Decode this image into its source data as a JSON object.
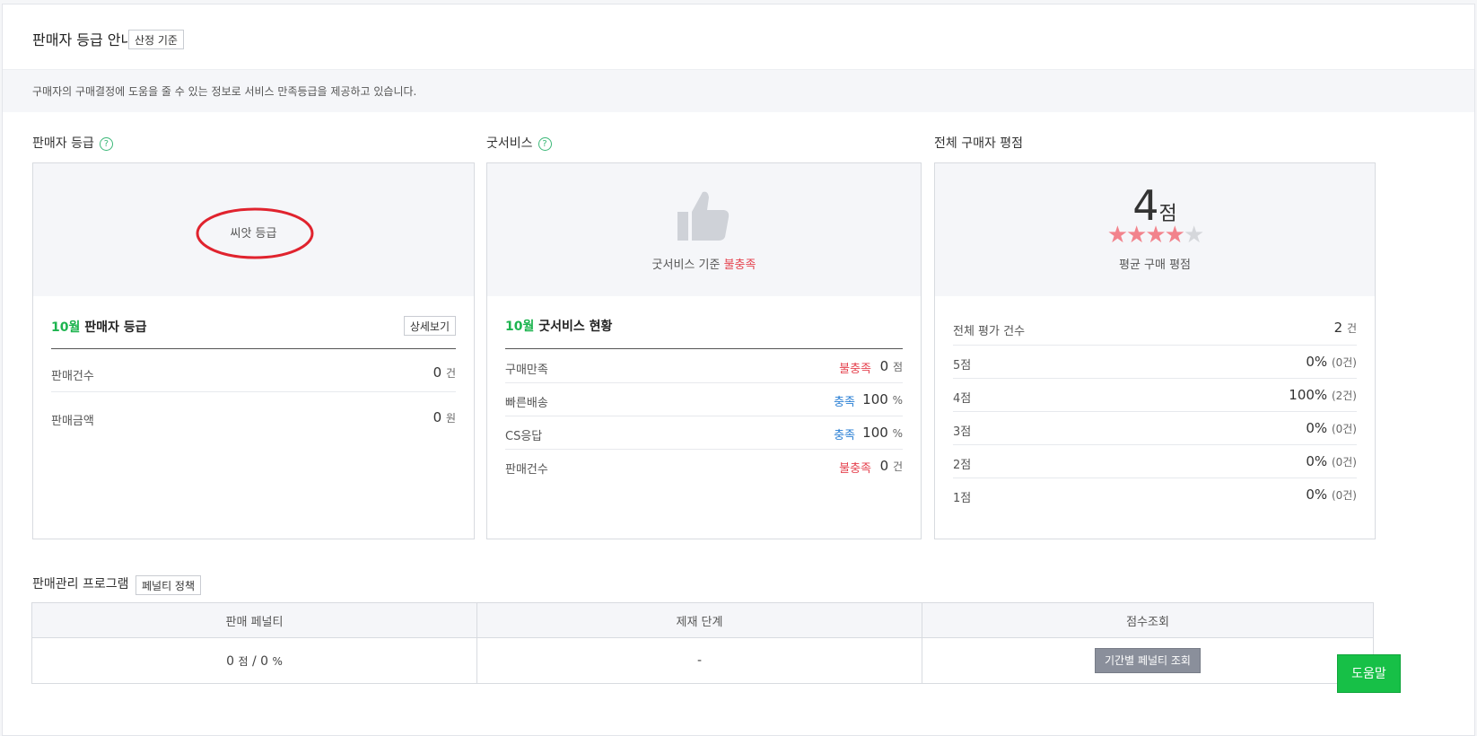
{
  "header": {
    "title": "판매자 등급 안내",
    "criteria_button": "산정 기준"
  },
  "info": {
    "text": "구매자의 구매결정에 도움을 줄 수 있는 정보로 서비스 만족등급을 제공하고 있습니다."
  },
  "grade": {
    "section_title": "판매자 등급",
    "help": "?",
    "grade_name": "씨앗 등급",
    "month": "10월",
    "subtitle": "판매자 등급",
    "detail_button": "상세보기",
    "rows": [
      {
        "label": "판매건수",
        "value": "0",
        "unit": "건"
      },
      {
        "label": "판매금액",
        "value": "0",
        "unit": "원"
      }
    ]
  },
  "good_service": {
    "section_title": "굿서비스",
    "help": "?",
    "criteria_text": "굿서비스 기준",
    "criteria_status": "불충족",
    "month": "10월",
    "subtitle": "굿서비스 현황",
    "rows": [
      {
        "label": "구매만족",
        "status": "불충족",
        "status_color": "#e5434f",
        "value": "0",
        "unit": "점"
      },
      {
        "label": "빠른배송",
        "status": "충족",
        "status_color": "#2a7fd4",
        "value": "100",
        "unit": "%"
      },
      {
        "label": "CS응답",
        "status": "충족",
        "status_color": "#2a7fd4",
        "value": "100",
        "unit": "%"
      },
      {
        "label": "판매건수",
        "status": "불충족",
        "status_color": "#e5434f",
        "value": "0",
        "unit": "건"
      }
    ]
  },
  "rating": {
    "section_title": "전체 구매자 평점",
    "score": "4",
    "score_unit": "점",
    "stars_filled": 4,
    "stars_total": 5,
    "avg_label": "평균 구매 평점",
    "total_label": "전체 평가 건수",
    "total_value": "2",
    "total_unit": "건",
    "rows": [
      {
        "label": "5점",
        "percent": "0%",
        "count": "(0건)"
      },
      {
        "label": "4점",
        "percent": "100%",
        "count": "(2건)"
      },
      {
        "label": "3점",
        "percent": "0%",
        "count": "(0건)"
      },
      {
        "label": "2점",
        "percent": "0%",
        "count": "(0건)"
      },
      {
        "label": "1점",
        "percent": "0%",
        "count": "(0건)"
      }
    ]
  },
  "program": {
    "title": "판매관리 프로그램",
    "policy_button": "페널티 정책",
    "columns": [
      "판매 페널티",
      "제재 단계",
      "점수조회"
    ],
    "penalty_score": "0",
    "penalty_score_unit": "점",
    "penalty_sep": "/",
    "penalty_percent": "0",
    "penalty_percent_unit": "%",
    "sanction": "-",
    "lookup_button": "기간별 페널티 조회"
  },
  "help_button": "도움말",
  "colors": {
    "accent_green": "#1db44f",
    "unmet_red": "#e5434f",
    "met_blue": "#2a7fd4",
    "star_pink": "#f2838c",
    "star_gray": "#d5d7db"
  }
}
